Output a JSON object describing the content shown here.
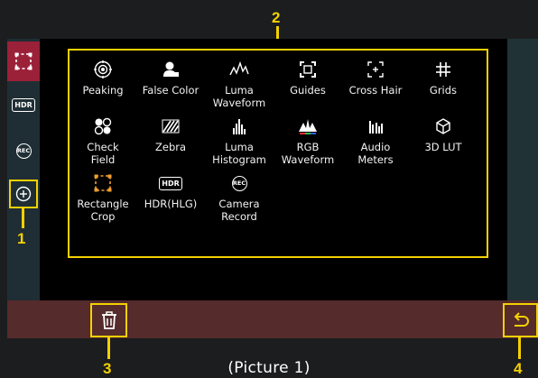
{
  "callouts": {
    "one": "1",
    "two": "2",
    "three": "3",
    "four": "4"
  },
  "caption": "(Picture 1)",
  "sidebar": {
    "hdr_label": "HDR",
    "rec_label": "REC"
  },
  "tools": [
    {
      "label": "Peaking",
      "icon": "peaking-icon"
    },
    {
      "label": "False Color",
      "icon": "false-color-icon"
    },
    {
      "label": "Luma\nWaveform",
      "icon": "luma-waveform-icon"
    },
    {
      "label": "Guides",
      "icon": "guides-icon"
    },
    {
      "label": "Cross Hair",
      "icon": "cross-hair-icon"
    },
    {
      "label": "Grids",
      "icon": "grids-icon"
    },
    {
      "label": "Check\nField",
      "icon": "check-field-icon"
    },
    {
      "label": "Zebra",
      "icon": "zebra-icon"
    },
    {
      "label": "Luma\nHistogram",
      "icon": "luma-histogram-icon"
    },
    {
      "label": "RGB\nWaveform",
      "icon": "rgb-waveform-icon"
    },
    {
      "label": "Audio\nMeters",
      "icon": "audio-meters-icon"
    },
    {
      "label": "3D LUT",
      "icon": "3d-lut-icon"
    },
    {
      "label": "Rectangle\nCrop",
      "icon": "rectangle-crop-icon"
    },
    {
      "label": "HDR(HLG)",
      "icon": "hdr-hlg-icon"
    },
    {
      "label": "Camera\nRecord",
      "icon": "camera-record-icon"
    }
  ],
  "tool_badges": {
    "hdr": "HDR",
    "rec": "REC"
  },
  "colors": {
    "accent_yellow": "#f4d100",
    "active_red": "#9b2138",
    "bottom_bar": "#552b2c",
    "sidebar": "#1f2e34",
    "crop_orange": "#f0a030"
  }
}
